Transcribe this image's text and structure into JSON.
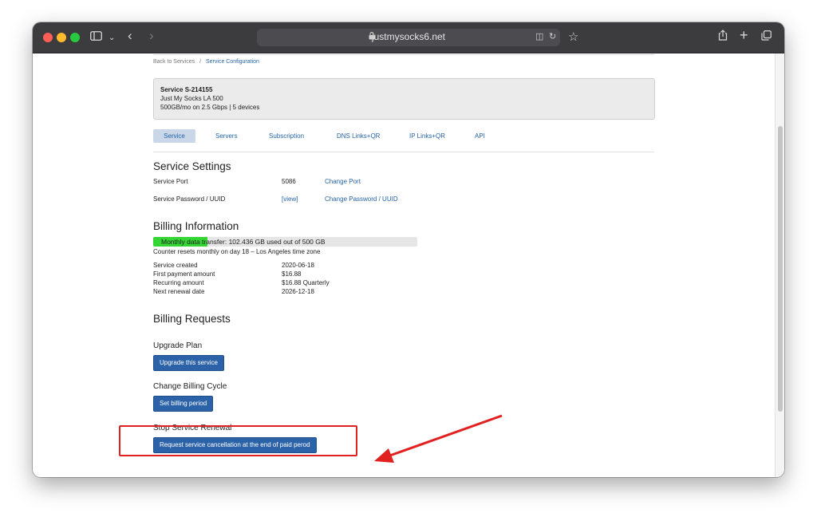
{
  "browser": {
    "url": "justmysocks6.net"
  },
  "breadcrumb": {
    "back": "Back to Services",
    "separator": "/",
    "current": "Service Configuration"
  },
  "service": {
    "title": "Service S-214155",
    "plan": "Just My Socks LA 500",
    "spec": "500GB/mo on 2.5 Gbps | 5 devices"
  },
  "tabs": [
    "Service",
    "Servers",
    "Subscription",
    "DNS Links+QR",
    "IP Links+QR",
    "API"
  ],
  "settings": {
    "heading": "Service Settings",
    "port_label": "Service Port",
    "port_value": "5086",
    "port_action": "Change Port",
    "password_label": "Service Password / UUID",
    "password_value": "[view]",
    "password_action": "Change Password / UUID"
  },
  "billing": {
    "heading": "Billing Information",
    "usage_text": "Monthly data transfer: 102.436 GB used out of 500 GB",
    "usage_used_gb": 102.436,
    "usage_total_gb": 500,
    "reset_text": "Counter resets monthly on day 18 – Los Angeles time zone",
    "rows": [
      {
        "label": "Service created",
        "value": "2020-06-18"
      },
      {
        "label": "First payment amount",
        "value": "$16.88"
      },
      {
        "label": "Recurring amount",
        "value": "$16.88 Quarterly"
      },
      {
        "label": "Next renewal date",
        "value": "2026-12-18"
      }
    ]
  },
  "requests": {
    "heading": "Billing Requests",
    "upgrade_heading": "Upgrade Plan",
    "upgrade_button": "Upgrade this service",
    "cycle_heading": "Change Billing Cycle",
    "cycle_button": "Set billing period",
    "stop_heading": "Stop Service Renewal",
    "stop_button": "Request service cancellation at the end of paid perod"
  },
  "colors": {
    "link": "#2563a6",
    "button": "#2c63a8",
    "usage_fill": "#33d633",
    "annotation": "#e12020"
  }
}
